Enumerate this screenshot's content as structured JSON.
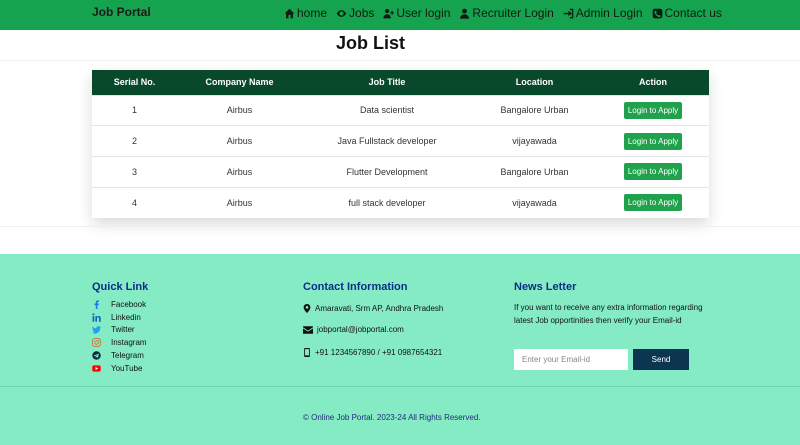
{
  "navbar": {
    "brand": "Job Portal",
    "items": [
      {
        "label": "home",
        "icon": "home-icon"
      },
      {
        "label": "Jobs",
        "icon": "eye-icon"
      },
      {
        "label": "User login",
        "icon": "user-plus-icon"
      },
      {
        "label": "Recruiter Login",
        "icon": "user-icon"
      },
      {
        "label": "Admin Login",
        "icon": "sign-in-icon"
      },
      {
        "label": "Contact us",
        "icon": "phone-icon"
      }
    ]
  },
  "page": {
    "title": "Job List"
  },
  "table": {
    "headers": [
      "Serial No.",
      "Company Name",
      "Job Title",
      "Location",
      "Action"
    ],
    "rows": [
      {
        "serial": "1",
        "company": "Airbus",
        "title": "Data scientist",
        "location": "Bangalore Urban",
        "action": "Login to Apply"
      },
      {
        "serial": "2",
        "company": "Airbus",
        "title": "Java Fullstack developer",
        "location": "vijayawada",
        "action": "Login to Apply"
      },
      {
        "serial": "3",
        "company": "Airbus",
        "title": "Flutter Development",
        "location": "Bangalore Urban",
        "action": "Login to Apply"
      },
      {
        "serial": "4",
        "company": "Airbus",
        "title": "full stack developer",
        "location": "vijayawada",
        "action": "Login to Apply"
      }
    ]
  },
  "footer": {
    "quick_link": {
      "heading": "Quick Link",
      "items": [
        {
          "label": "Facebook",
          "icon": "facebook-icon",
          "color": "#1877f2"
        },
        {
          "label": "Linkedin",
          "icon": "linkedin-icon",
          "color": "#0a66c2"
        },
        {
          "label": "Twitter",
          "icon": "twitter-icon",
          "color": "#1da1f2"
        },
        {
          "label": "Instagram",
          "icon": "instagram-icon",
          "color": "#e1306c"
        },
        {
          "label": "Telegram",
          "icon": "telegram-icon",
          "color": "#0b2a3a"
        },
        {
          "label": "YouTube",
          "icon": "youtube-icon",
          "color": "#ff0000"
        }
      ]
    },
    "contact": {
      "heading": "Contact Information",
      "address": "Amaravati, Srm AP, Andhra Pradesh",
      "email": "jobportal@jobportal.com",
      "phone": "+91 1234567890 / +91 0987654321"
    },
    "newsletter": {
      "heading": "News Letter",
      "text": "If you want to receive any extra information regarding latest Job opportinities then verify your Email-id",
      "placeholder": "Enter your Email-id",
      "button": "Send"
    },
    "copyright": "© Online Job Portal. 2023-24 All Rights Reserved."
  },
  "colors": {
    "navbar": "#15a34f",
    "table_header": "#08492c",
    "apply_button": "#20a14c",
    "footer_bg": "#85ebc4",
    "footer_heading": "#0c2d86",
    "send_button": "#0c3550"
  }
}
